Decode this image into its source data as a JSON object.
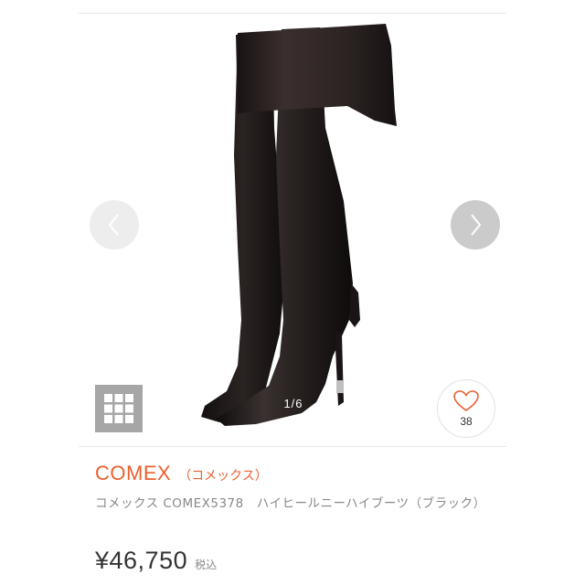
{
  "gallery": {
    "counter": "1/6",
    "prev_icon": "chevron-left-icon",
    "next_icon": "chevron-right-icon",
    "grid_icon": "grid-icon",
    "favorite_icon": "heart-icon",
    "favorite_count": "38",
    "image": "black-over-knee-high-heel-boot"
  },
  "product": {
    "brand": "COMEX",
    "brand_kana": "（コメックス）",
    "name": "コメックス COMEX5378　ハイヒールニーハイブーツ（ブラック）",
    "price": "¥46,750",
    "tax_label": "税込"
  },
  "colors": {
    "brand": "#ea5f2e",
    "price": "#333333",
    "subtext": "#888888",
    "grid_button": "#a6a6a6"
  }
}
